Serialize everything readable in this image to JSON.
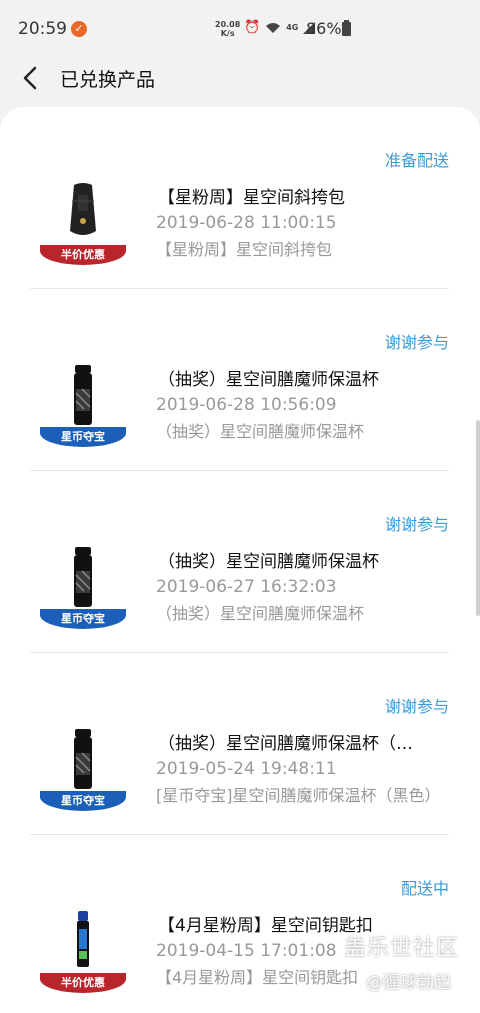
{
  "status_bar": {
    "time": "20:59",
    "badge": "✓",
    "net_speed_value": "20.08",
    "net_speed_unit": "K/s",
    "signal": "4G",
    "battery": "86%"
  },
  "header": {
    "title": "已兑换产品"
  },
  "orders": [
    {
      "status": "准备配送",
      "name": "【星粉周】星空间斜挎包",
      "time": "2019-06-28 11:00:15",
      "desc": "【星粉周】星空间斜挎包",
      "tag": "半价优惠",
      "tag_color": "#b8262b",
      "product": "bag"
    },
    {
      "status": "谢谢参与",
      "name": "（抽奖）星空间膳魔师保温杯",
      "time": "2019-06-28 10:56:09",
      "desc": "（抽奖）星空间膳魔师保温杯",
      "tag": "星币夺宝",
      "tag_color": "#1c5fb8",
      "product": "thermos"
    },
    {
      "status": "谢谢参与",
      "name": "（抽奖）星空间膳魔师保温杯",
      "time": "2019-06-27 16:32:03",
      "desc": "（抽奖）星空间膳魔师保温杯",
      "tag": "星币夺宝",
      "tag_color": "#1c5fb8",
      "product": "thermos"
    },
    {
      "status": "谢谢参与",
      "name": "（抽奖）星空间膳魔师保温杯（…",
      "time": "2019-05-24 19:48:11",
      "desc": "[星币夺宝]星空间膳魔师保温杯（黑色）",
      "tag": "星币夺宝",
      "tag_color": "#1c5fb8",
      "product": "thermos"
    },
    {
      "status": "配送中",
      "name": "【4月星粉周】星空间钥匙扣",
      "time": "2019-04-15 17:01:08",
      "desc": "【4月星粉周】星空间钥匙扣",
      "tag": "半价优惠",
      "tag_color": "#b8262b",
      "product": "keychain"
    }
  ],
  "watermark": {
    "title": "盖乐世社区",
    "author": "@猩球勃起"
  },
  "accent_color": "#3a9bd6"
}
